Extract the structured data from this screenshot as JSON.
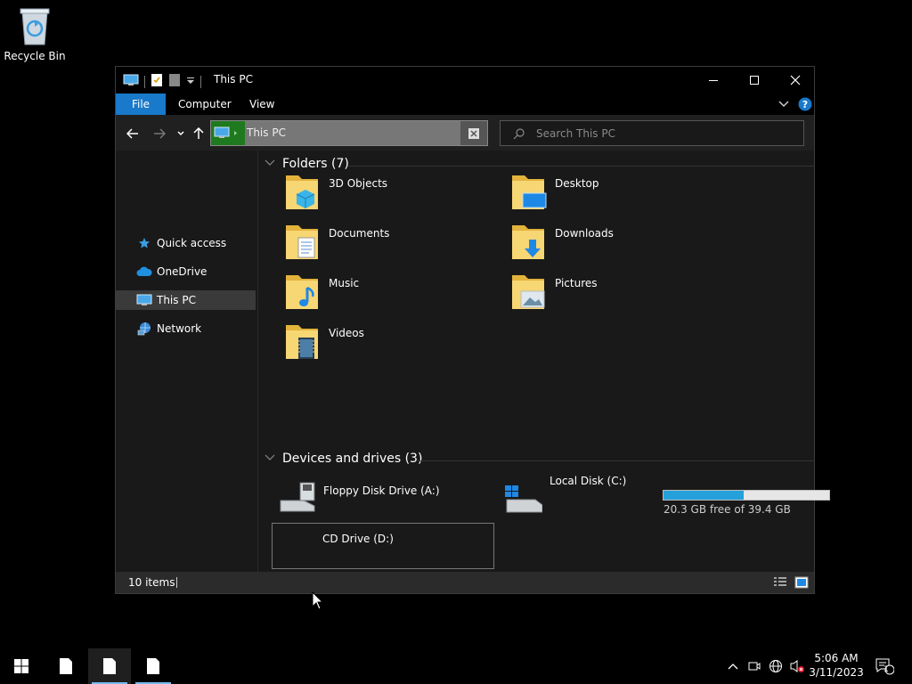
{
  "desktop": {
    "recycle_bin_label": "Recycle Bin"
  },
  "window": {
    "title": "This PC",
    "ribbon_tabs": [
      "File",
      "Computer",
      "View"
    ],
    "address": {
      "text": "This PC"
    },
    "search": {
      "placeholder": "Search This PC"
    }
  },
  "navpane": {
    "items": [
      {
        "label": "Quick access",
        "icon": "star-icon"
      },
      {
        "label": "OneDrive",
        "icon": "cloud-icon"
      },
      {
        "label": "This PC",
        "icon": "computer-icon",
        "selected": true
      },
      {
        "label": "Network",
        "icon": "network-icon"
      }
    ]
  },
  "folders": {
    "header": "Folders (7)",
    "items": [
      {
        "name": "3D Objects",
        "icon": "3d-objects-folder-icon"
      },
      {
        "name": "Desktop",
        "icon": "desktop-folder-icon"
      },
      {
        "name": "Documents",
        "icon": "documents-folder-icon"
      },
      {
        "name": "Downloads",
        "icon": "downloads-folder-icon"
      },
      {
        "name": "Music",
        "icon": "music-folder-icon"
      },
      {
        "name": "Pictures",
        "icon": "pictures-folder-icon"
      },
      {
        "name": "Videos",
        "icon": "videos-folder-icon"
      }
    ]
  },
  "drives": {
    "header": "Devices and drives (3)",
    "items": [
      {
        "name": "Floppy Disk Drive (A:)",
        "icon": "floppy-drive-icon"
      },
      {
        "name": "Local Disk (C:)",
        "icon": "local-disk-icon",
        "free_text": "20.3 GB free of 39.4 GB",
        "used_fraction": 0.485,
        "bar_color": "#26a0da"
      },
      {
        "name": "CD Drive (D:)",
        "icon": "cd-drive-icon"
      }
    ]
  },
  "status": {
    "items_count": "10 items"
  },
  "taskbar": {
    "time": "5:06 AM",
    "date": "3/11/2023",
    "notification_count": "1"
  },
  "colors": {
    "accent": "#1979ca",
    "background": "#191919"
  }
}
